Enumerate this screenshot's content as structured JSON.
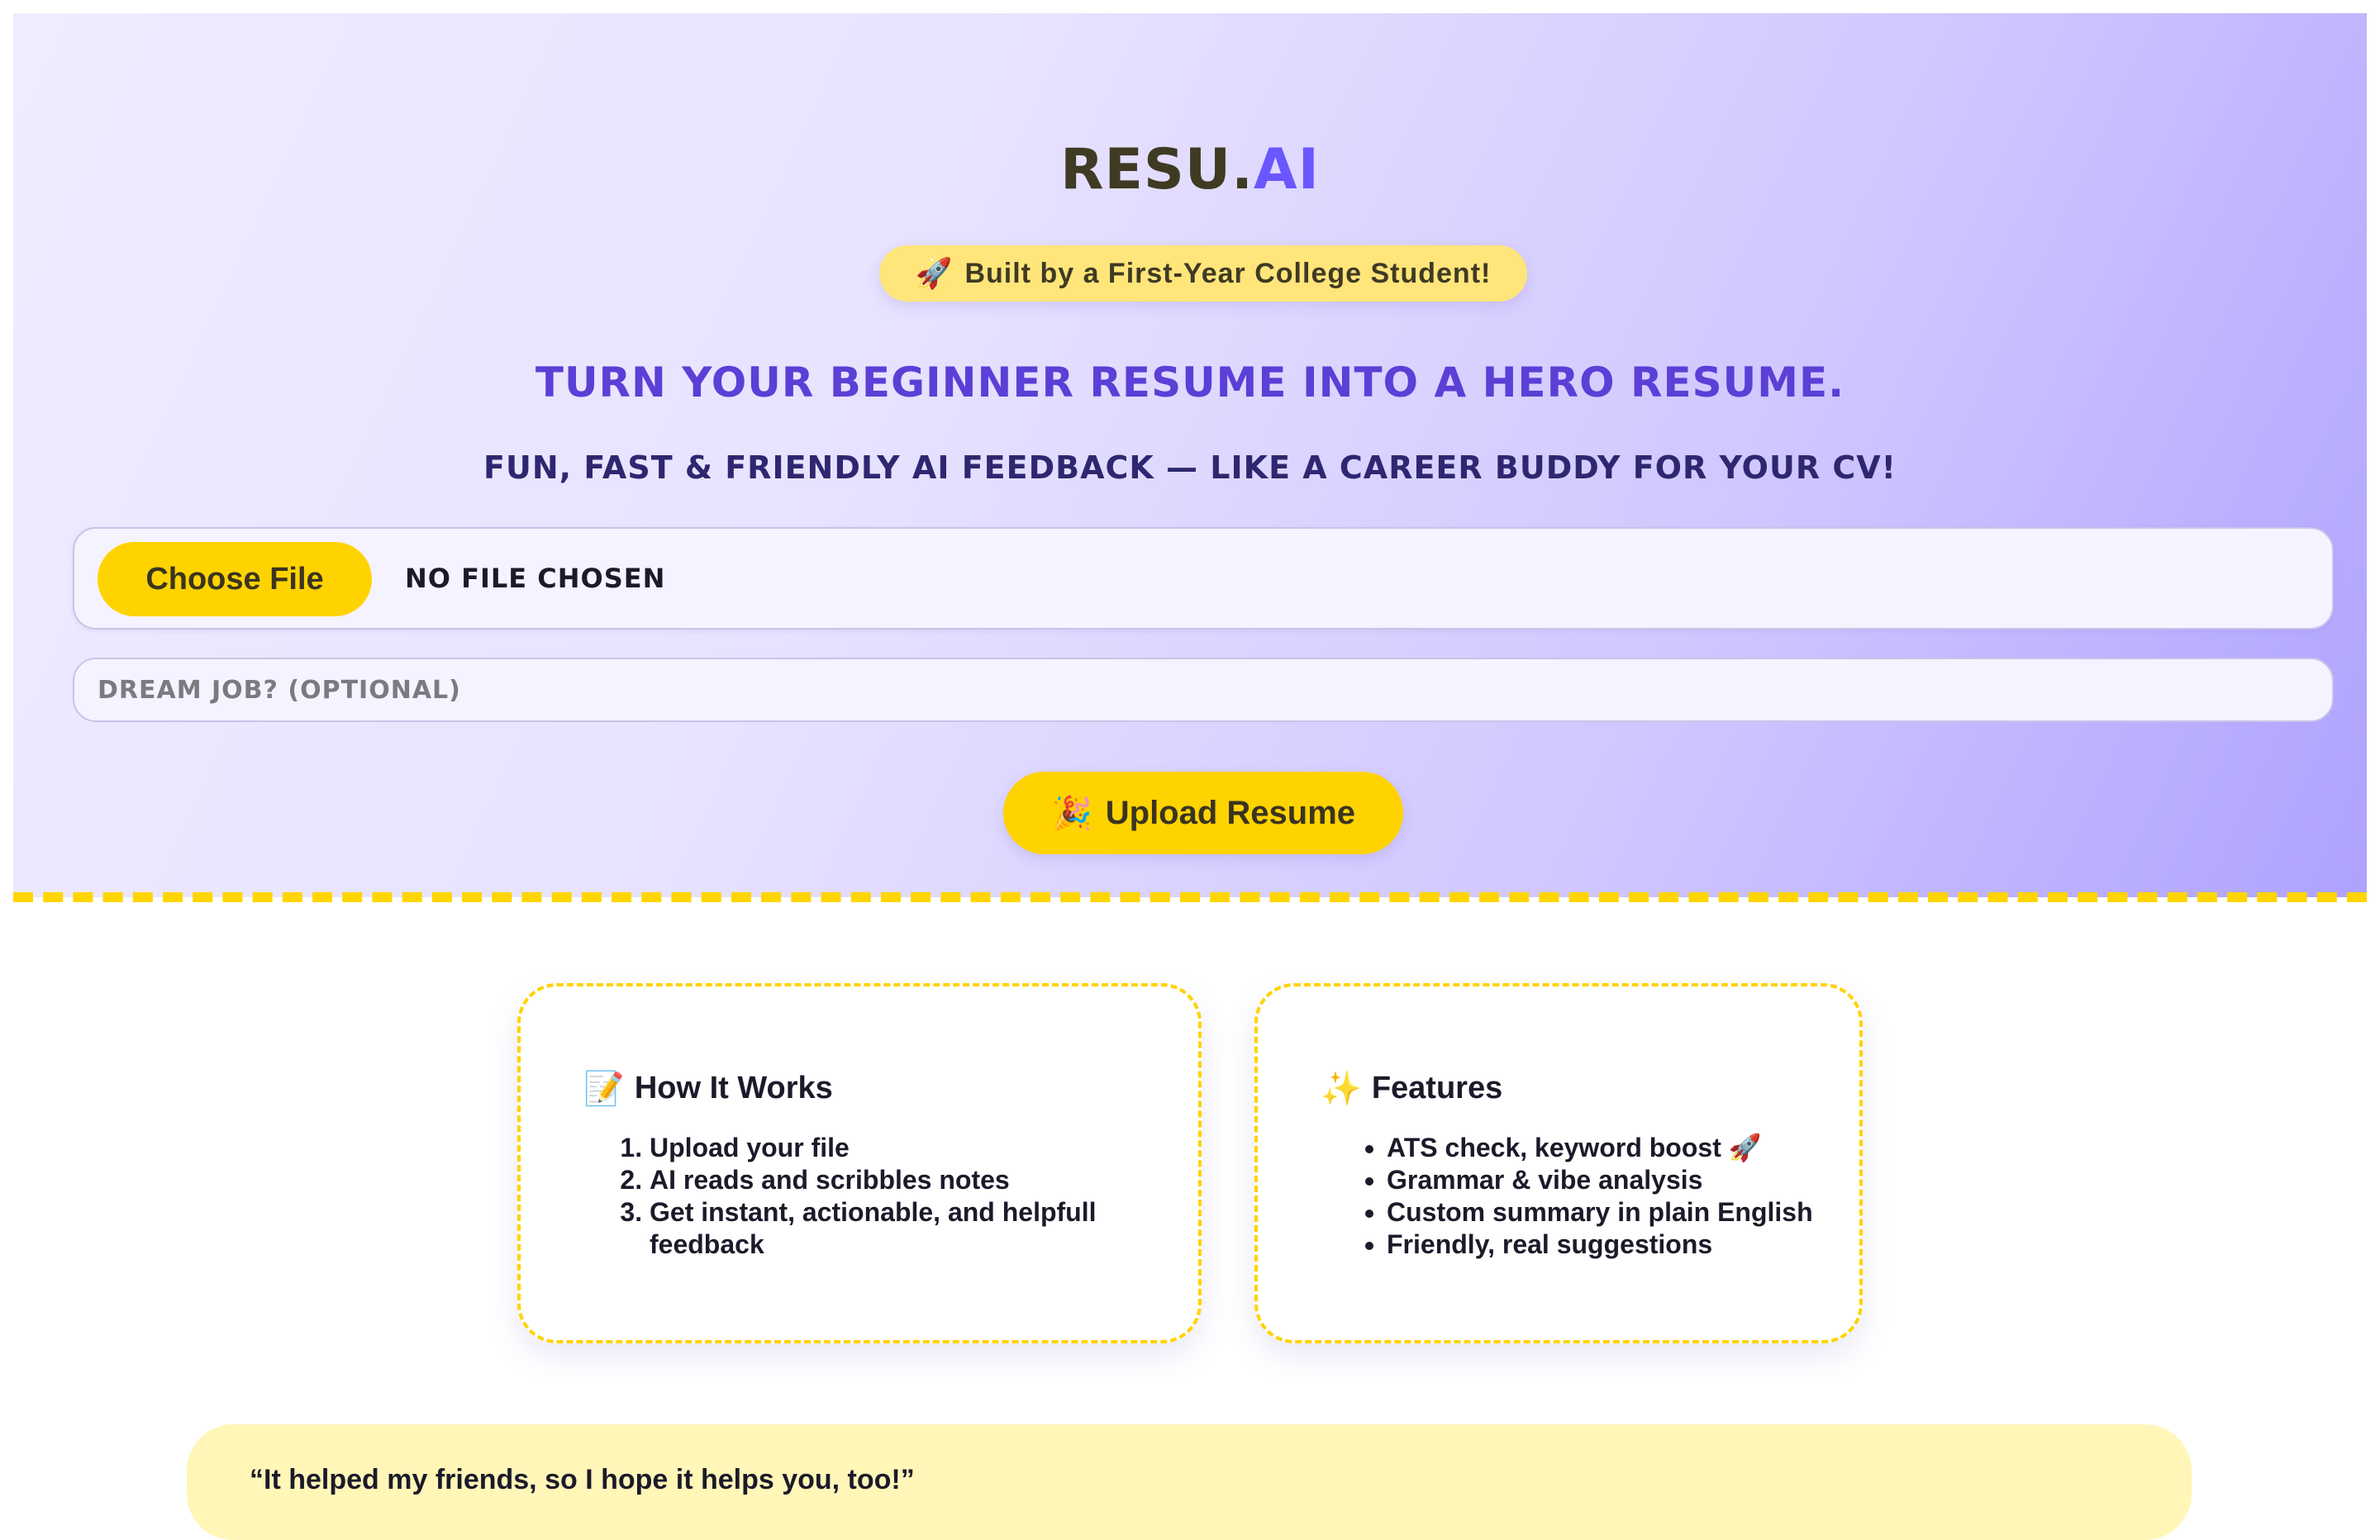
{
  "brand": {
    "name_main": "RESU.",
    "name_accent": "AI",
    "accent_color": "#6b57ff"
  },
  "badge": {
    "icon": "rocket-icon",
    "emoji": "🚀",
    "text": "Built by a First-Year College Student!"
  },
  "hero": {
    "headline": "Turn your beginner resume into a hero resume.",
    "subheadline": "Fun, fast & friendly AI feedback — like a career buddy for your CV!"
  },
  "upload_form": {
    "choose_file_label": "Choose File",
    "file_status": "No file chosen",
    "dream_job_placeholder": "Dream job? (optional)",
    "dream_job_value": "",
    "upload_button_label": "Upload Resume",
    "upload_button_icon": "party-popper-icon",
    "upload_button_emoji": "🎉"
  },
  "how_it_works": {
    "icon": "memo-icon",
    "emoji": "📝",
    "title": "How It Works",
    "steps": [
      "Upload your file",
      "AI reads and scribbles notes",
      "Get instant, actionable, and helpfull feedback"
    ]
  },
  "features": {
    "icon": "sparkles-icon",
    "emoji": "✨",
    "title": "Features",
    "items": [
      "ATS check, keyword boost 🚀",
      "Grammar & vibe analysis",
      "Custom summary in plain English",
      "Friendly, real suggestions"
    ]
  },
  "testimonial": {
    "quote": "“It helped my friends, so I hope it helps you, too!”"
  },
  "colors": {
    "accent_yellow": "#ffd300",
    "badge_yellow": "#ffe57a",
    "headline_purple": "#5b3fd6",
    "quote_bg": "#fff6b8"
  }
}
